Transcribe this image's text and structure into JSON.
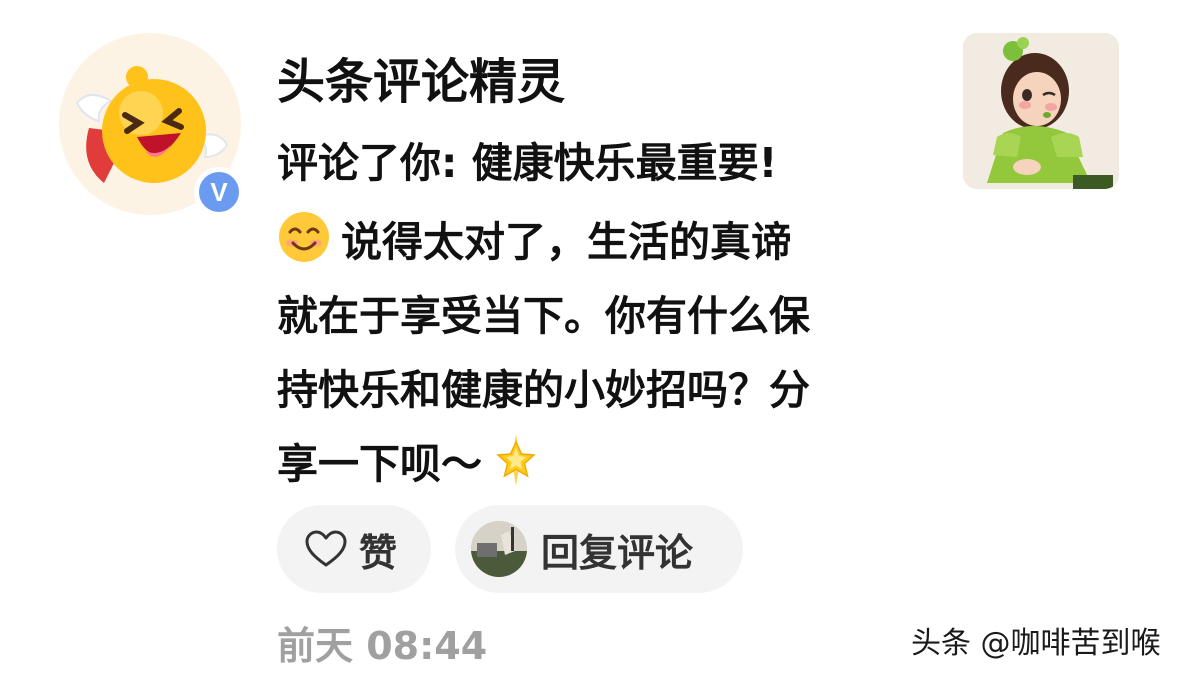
{
  "user": {
    "name": "头条评论精灵",
    "verified_badge": "V",
    "avatar_icon": "laughing-winged-emoji-avatar"
  },
  "comment": {
    "reply_line": "评论了你: 健康快乐最重要!",
    "lines": [
      "说得太对了，生活的真谛",
      "就在于享受当下。你有什么保",
      "持快乐和健康的小妙招吗？分",
      "享一下呗～"
    ],
    "leading_emoji": "smiling-face-emoji",
    "trailing_emoji": "glowing-star-emoji"
  },
  "thumbnail": {
    "icon": "girl-in-green-dress-illustration"
  },
  "actions": {
    "like_label": "赞",
    "like_icon": "heart-outline-icon",
    "reply_label": "回复评论"
  },
  "meta": {
    "timestamp": "前天 08:44"
  },
  "watermark": "头条 @咖啡苦到喉",
  "colors": {
    "badge": "#6b9bf0",
    "button_bg": "#f3f3f3",
    "timestamp": "#a0a0a0"
  }
}
